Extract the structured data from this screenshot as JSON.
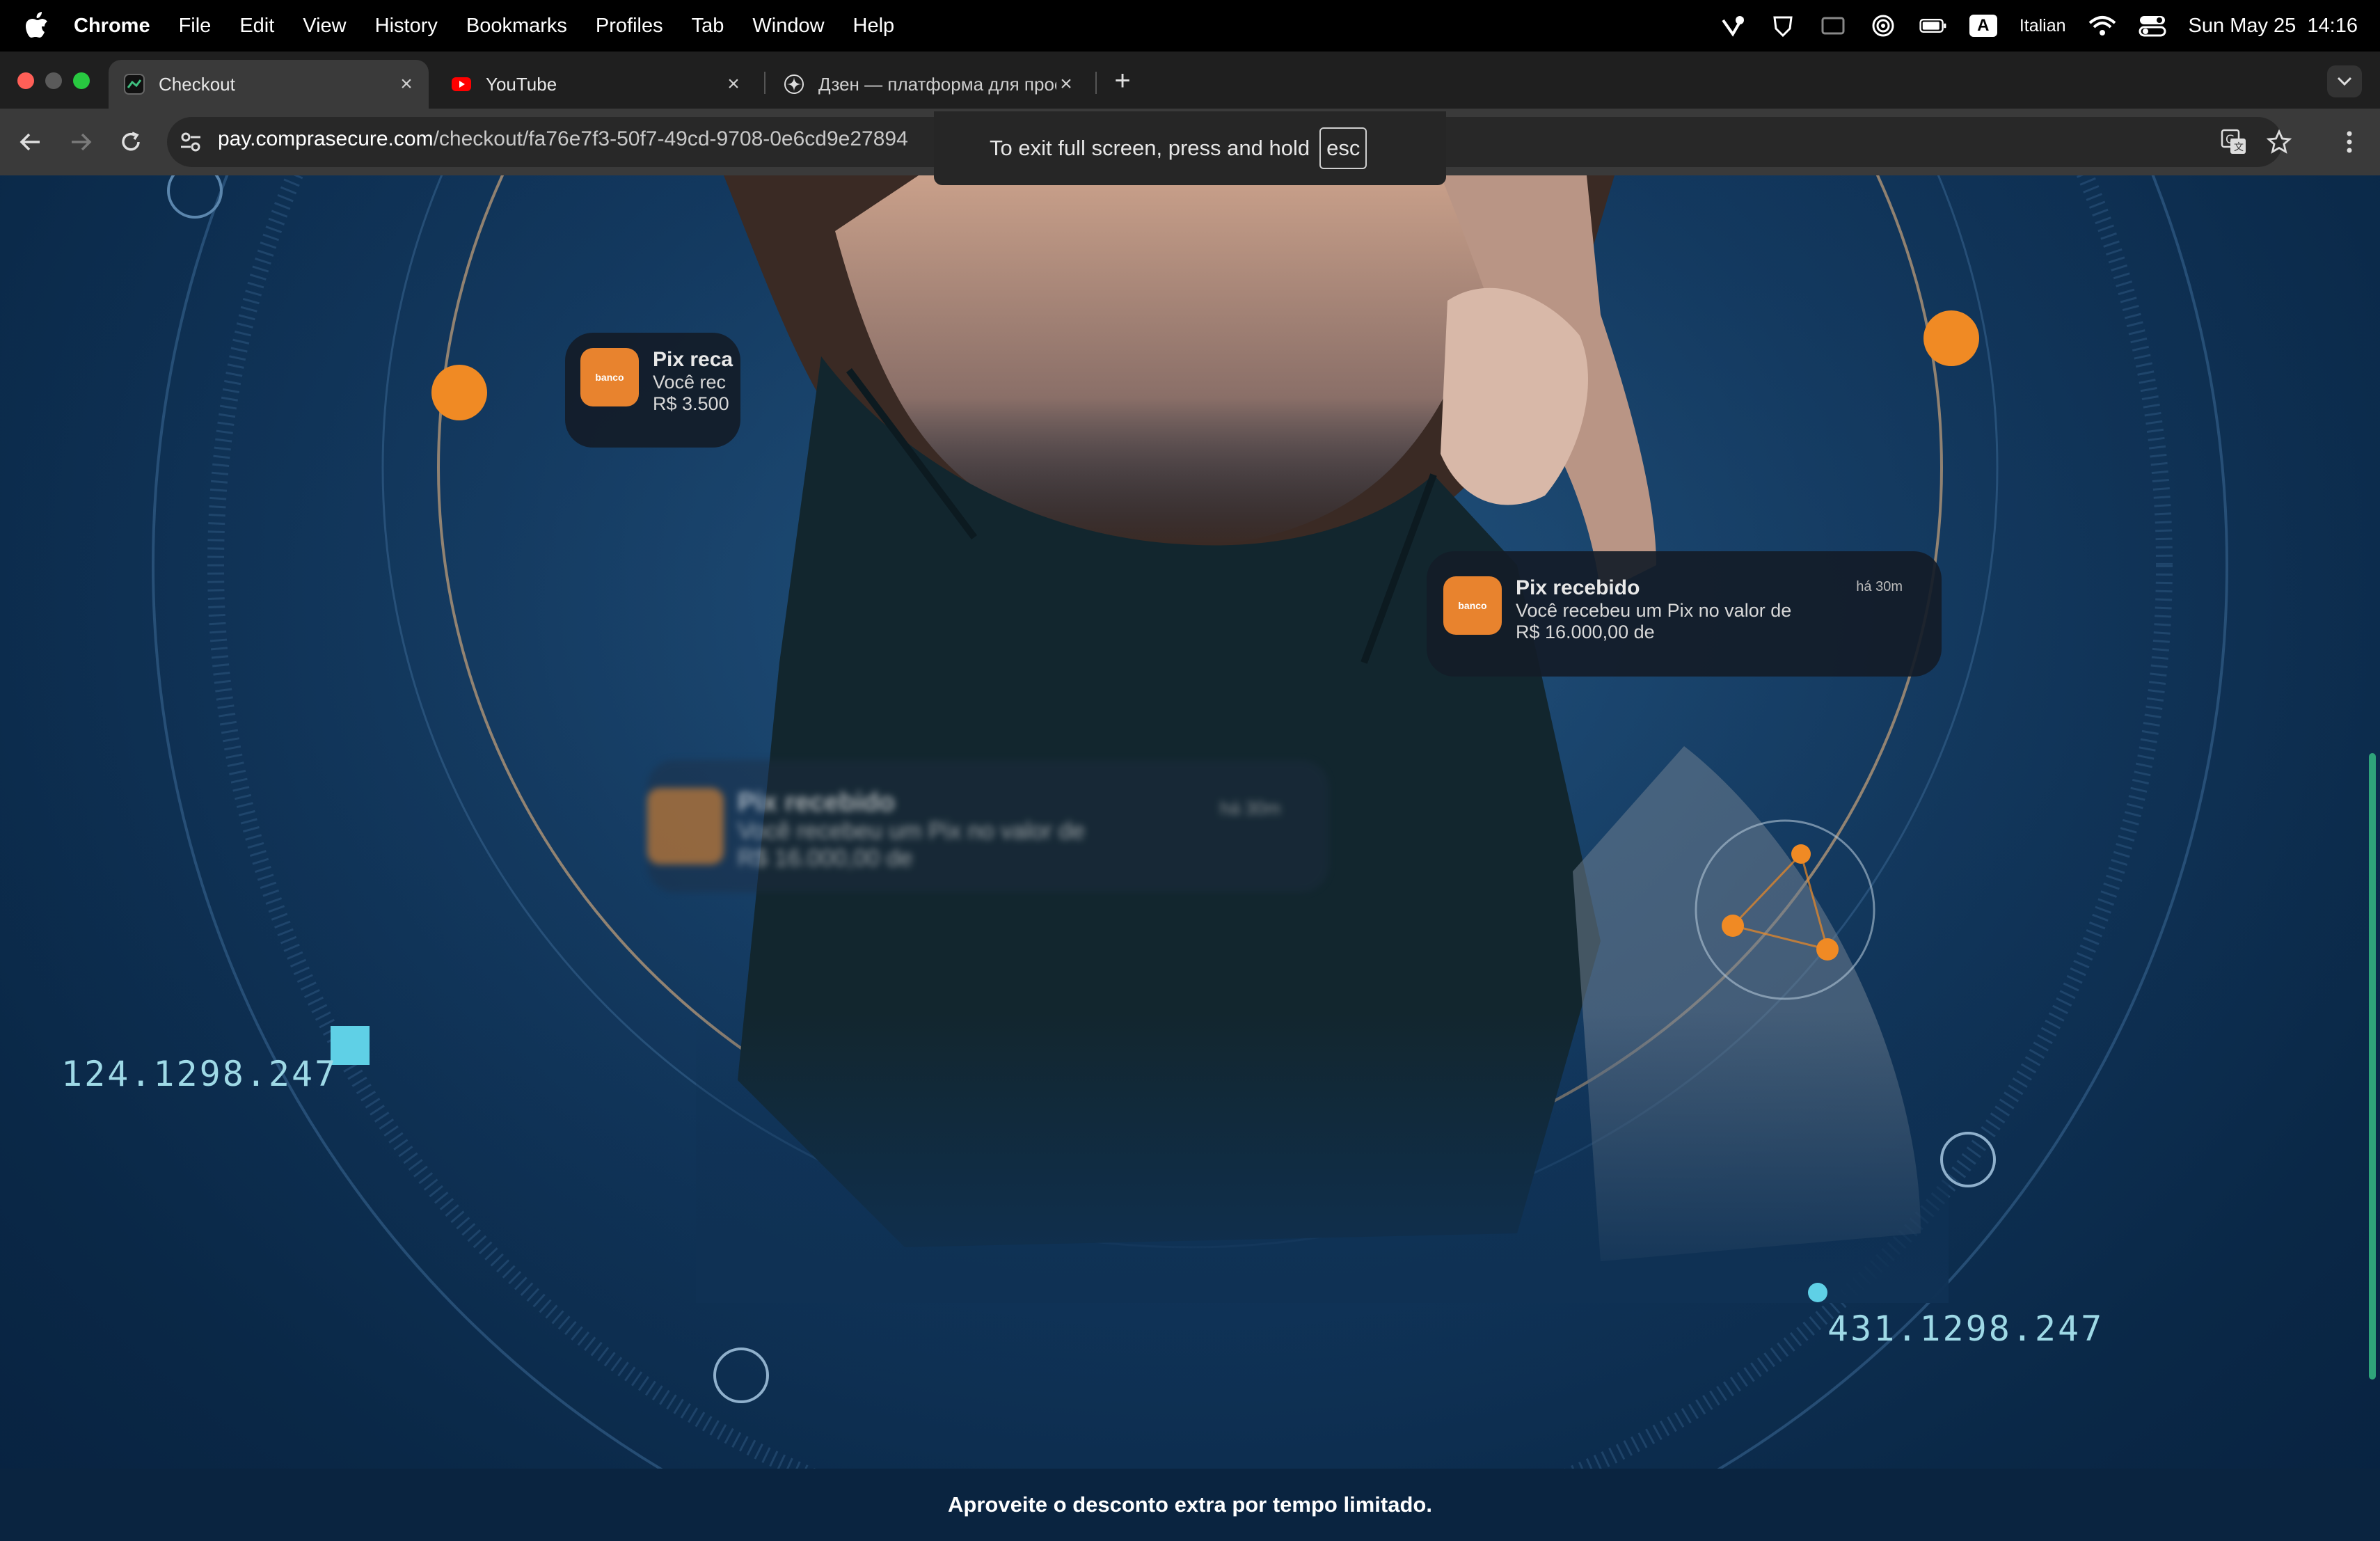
{
  "menubar": {
    "app": "Chrome",
    "items": [
      "File",
      "Edit",
      "View",
      "History",
      "Bookmarks",
      "Profiles",
      "Tab",
      "Window",
      "Help"
    ],
    "input_source": "Italian",
    "input_badge": "A",
    "datetime": "Sun May 25  14:16"
  },
  "tabs": [
    {
      "title": "Checkout",
      "icon": "checkout-favicon"
    },
    {
      "title": "YouTube",
      "icon": "youtube-favicon"
    },
    {
      "title": "Дзен — платформа для прос",
      "icon": "dzen-favicon"
    }
  ],
  "toolbar": {
    "url_host": "pay.comprasecure.com",
    "url_path": "/checkout/fa76e7f3-50f7-49cd-9708-0e6cd9e27894"
  },
  "fullscreen_bubble": {
    "text": "To exit full screen, press and hold",
    "key": "esc"
  },
  "hero": {
    "notif_small": {
      "title": "Pix reca",
      "line1": "Você rec",
      "line2": "R$ 3.500"
    },
    "notif_main": {
      "title": "Pix recebido",
      "line1": "Você recebeu um Pix no valor de",
      "line2": "R$ 16.000,00 de",
      "time": "há 30m"
    },
    "notif_blur": {
      "title": "Pix recebido",
      "line1": "Você recebeu um Pix no valor de",
      "line2": "R$ 16.000,00 de",
      "time": "há 30m"
    },
    "label_left": "124.1298.247",
    "label_right": "431.1298.247"
  },
  "footer": {
    "text": "Aproveite o desconto extra por tempo limitado."
  },
  "colors": {
    "accent_orange": "#f08a24",
    "cyan": "#5fd0e6",
    "bg_blue": "#0b2a4a"
  }
}
